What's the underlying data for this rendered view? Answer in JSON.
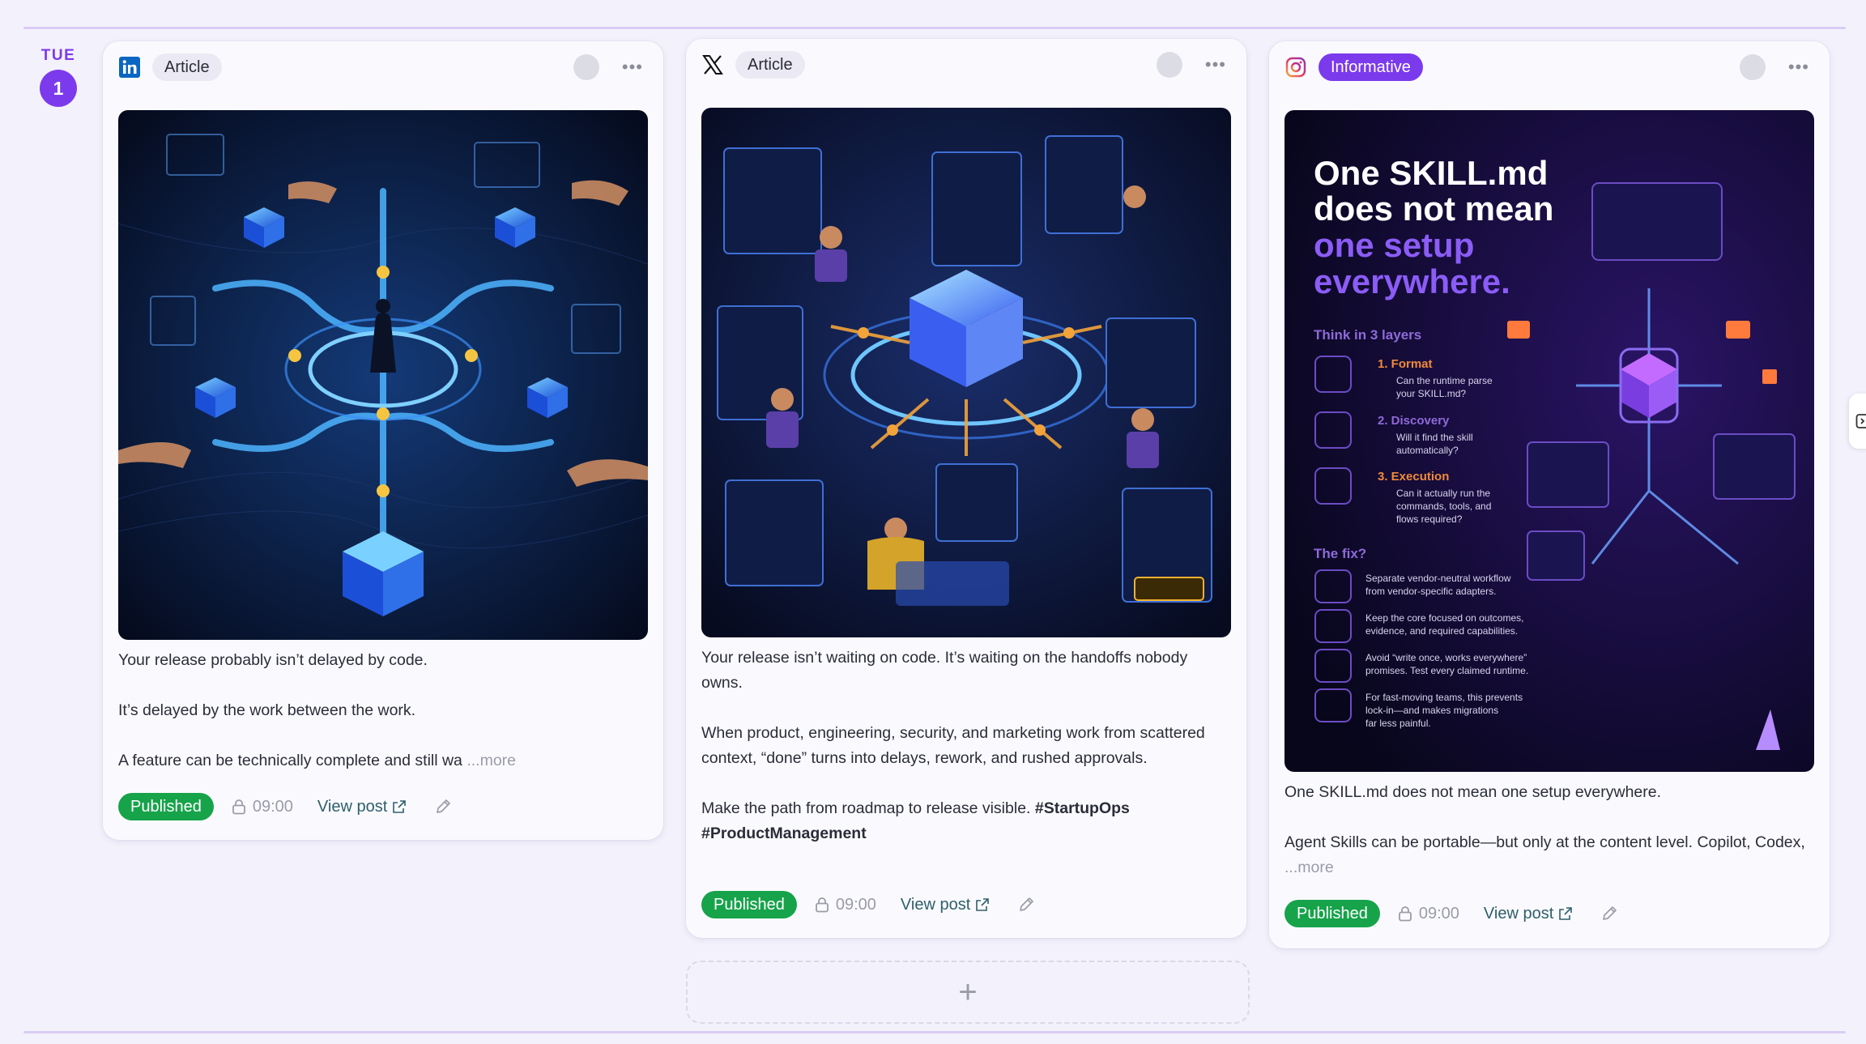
{
  "day": {
    "name": "TUE",
    "number": "1"
  },
  "colors": {
    "accent": "#7c3aed",
    "published": "#16a34a",
    "linkedin": "#0a66c2",
    "instagram": "#dd2a7b"
  },
  "cards": [
    {
      "platform": "LinkedIn",
      "platform_icon": "linkedin-icon",
      "type_label": "Article",
      "paragraphs": [
        "Your release probably isn’t delayed by code.",
        "It’s delayed by the work between the work.",
        "A feature can be technically complete and still wa"
      ],
      "more_label": "...more",
      "status_label": "Published",
      "time": "09:00",
      "view_label": "View post"
    },
    {
      "platform": "X",
      "platform_icon": "x-icon",
      "type_label": "Article",
      "paragraphs": [
        "Your release isn’t waiting on code. It’s waiting on the handoffs nobody owns.",
        "When product, engineering, security, and marketing work from scattered context, “done” turns into delays, rework, and rushed approvals.",
        "Make the path from roadmap to release visible."
      ],
      "hashtag_1": "#StartupOps",
      "hashtag_2": "#ProductManagement",
      "status_label": "Published",
      "time": "09:00",
      "view_label": "View post"
    },
    {
      "platform": "Instagram",
      "platform_icon": "instagram-icon",
      "type_label": "Informative",
      "paragraphs": [
        "One SKILL.md does not mean one setup everywhere.",
        "Agent Skills can be portable—but only at the content level. Copilot, Codex,"
      ],
      "more_label": "...more",
      "status_label": "Published",
      "time": "09:00",
      "view_label": "View post",
      "image_text": {
        "headline_1": "One SKILL.md",
        "headline_2": "does not mean",
        "headline_3": "one setup",
        "headline_4": "everywhere.",
        "subhead": "Think in 3 layers",
        "layer_1_title": "1. Format",
        "layer_1_desc_a": "Can the runtime parse",
        "layer_1_desc_b": "your SKILL.md?",
        "layer_2_title": "2. Discovery",
        "layer_2_desc_a": "Will it find the skill",
        "layer_2_desc_b": "automatically?",
        "layer_3_title": "3. Execution",
        "layer_3_desc_a": "Can it actually run the",
        "layer_3_desc_b": "commands, tools, and",
        "layer_3_desc_c": "flows required?",
        "fix_title": "The fix?",
        "fix_1a": "Separate vendor-neutral workflow",
        "fix_1b": "from vendor-specific adapters.",
        "fix_2a": "Keep the core focused on outcomes,",
        "fix_2b": "evidence, and required capabilities.",
        "fix_3a": "Avoid “write once, works everywhere”",
        "fix_3b": "promises. Test every claimed runtime.",
        "fix_4a": "For fast-moving teams, this prevents",
        "fix_4b": "lock-in—and makes migrations",
        "fix_4c": "far less painful."
      }
    }
  ],
  "add_label": "+"
}
